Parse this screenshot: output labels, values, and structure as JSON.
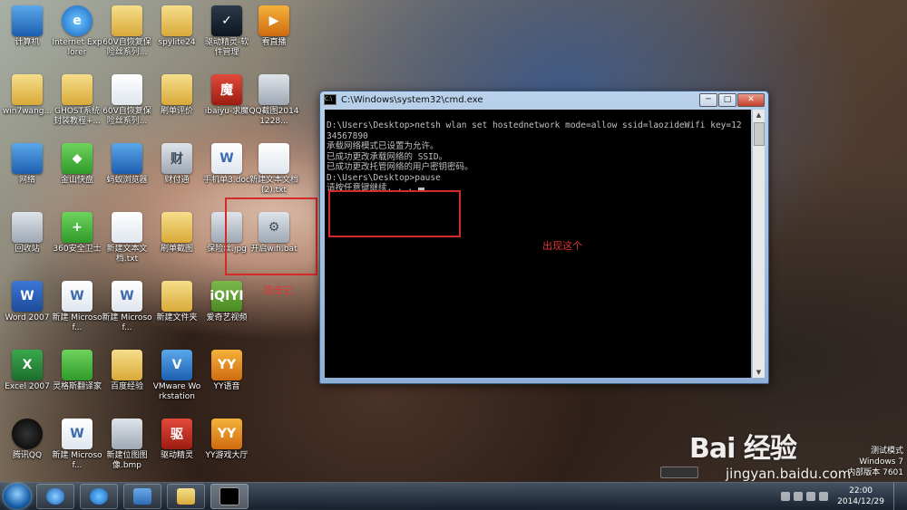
{
  "desktop": {
    "icons": [
      {
        "label": "计算机",
        "glyph": "",
        "kind": "blue"
      },
      {
        "label": "Internet Explorer",
        "glyph": "e",
        "kind": "ie"
      },
      {
        "label": "60V自恢复保险丝系列...",
        "glyph": "",
        "kind": "folder"
      },
      {
        "label": "spylite24",
        "glyph": "",
        "kind": "folder"
      },
      {
        "label": "驱动精灵-软件管理",
        "glyph": "✓",
        "kind": "dark"
      },
      {
        "label": "看直播",
        "glyph": "▶",
        "kind": "orange"
      },
      {
        "label": "win7wang...",
        "glyph": "",
        "kind": "folder"
      },
      {
        "label": "GHOST系统封装教程+...",
        "glyph": "",
        "kind": "folder"
      },
      {
        "label": "60V自恢复保险丝系列...",
        "glyph": "",
        "kind": "doc"
      },
      {
        "label": "刷单评价",
        "glyph": "",
        "kind": "folder"
      },
      {
        "label": "ibaiyu-求魔",
        "glyph": "魔",
        "kind": "red"
      },
      {
        "label": "QQ截图20141228...",
        "glyph": "",
        "kind": "gray"
      },
      {
        "label": "网络",
        "glyph": "",
        "kind": "blue"
      },
      {
        "label": "金山快盘",
        "glyph": "◆",
        "kind": "green"
      },
      {
        "label": "蚂蚁浏览器",
        "glyph": "",
        "kind": "blue"
      },
      {
        "label": "财付通",
        "glyph": "财",
        "kind": "gray"
      },
      {
        "label": "手机单3.doc",
        "glyph": "W",
        "kind": "doc"
      },
      {
        "label": "新建文本文档 (2).txt",
        "glyph": "",
        "kind": "doc"
      },
      {
        "label": "回收站",
        "glyph": "",
        "kind": "gray"
      },
      {
        "label": "360安全卫士",
        "glyph": "+",
        "kind": "green"
      },
      {
        "label": "新建文本文档.txt",
        "glyph": "",
        "kind": "doc"
      },
      {
        "label": "刷单截图",
        "glyph": "",
        "kind": "folder"
      },
      {
        "label": "保险丝.jpg",
        "glyph": "",
        "kind": "gray"
      },
      {
        "label": "开启wifi.bat",
        "glyph": "⚙",
        "kind": "gray"
      },
      {
        "label": "Word 2007",
        "glyph": "W",
        "kind": "word"
      },
      {
        "label": "新建 Microsof...",
        "glyph": "W",
        "kind": "doc"
      },
      {
        "label": "新建 Microsof...",
        "glyph": "W",
        "kind": "doc"
      },
      {
        "label": "新建文件夹",
        "glyph": "",
        "kind": "folder"
      },
      {
        "label": "爱奇艺视频",
        "glyph": "iQIYI",
        "kind": "purple"
      },
      {
        "label": "Excel 2007",
        "glyph": "X",
        "kind": "excel"
      },
      {
        "label": "灵格斯翻译家",
        "glyph": "",
        "kind": "green"
      },
      {
        "label": "百度经验",
        "glyph": "",
        "kind": "folder"
      },
      {
        "label": "VMware Workstation",
        "glyph": "V",
        "kind": "blue"
      },
      {
        "label": "YY语音",
        "glyph": "YY",
        "kind": "orange"
      },
      {
        "label": "腾讯QQ",
        "glyph": "",
        "kind": "qq"
      },
      {
        "label": "新建 Microsof...",
        "glyph": "W",
        "kind": "doc"
      },
      {
        "label": "新建位图图像.bmp",
        "glyph": "",
        "kind": "gray"
      },
      {
        "label": "驱动精灵",
        "glyph": "驱",
        "kind": "red"
      },
      {
        "label": "YY游戏大厅",
        "glyph": "YY",
        "kind": "orange"
      }
    ]
  },
  "cmd": {
    "title": "C:\\Windows\\system32\\cmd.exe",
    "icon_name": "console-icon",
    "lines": [
      "D:\\Users\\Desktop>netsh wlan set hostednetwork mode=allow ssid=laozideWifi key=12",
      "34567890",
      "承载网络模式已设置为允许。",
      "已成功更改承载网络的 SSID。",
      "已成功更改托管网络的用户密钥密码。",
      "",
      "",
      "D:\\Users\\Desktop>pause",
      "请按任意键继续. . . "
    ],
    "controls": {
      "minimize": "─",
      "maximize": "□",
      "close": "✕"
    }
  },
  "annotations": {
    "double_click": "双击它",
    "appears": "出现这个",
    "color": "#d32a2a"
  },
  "watermark": {
    "brand": "Bai 经验",
    "url": "jingyan.baidu.com"
  },
  "win_info": {
    "mode": "测试模式",
    "os": "Windows 7",
    "build": "内部版本 7601"
  },
  "taskbar": {
    "items": [
      "start-orb",
      "browser-icon",
      "ie-icon",
      "reader-icon",
      "explorer-icon",
      "cmd-icon"
    ],
    "time": "22:00",
    "date": "2014/12/29"
  }
}
